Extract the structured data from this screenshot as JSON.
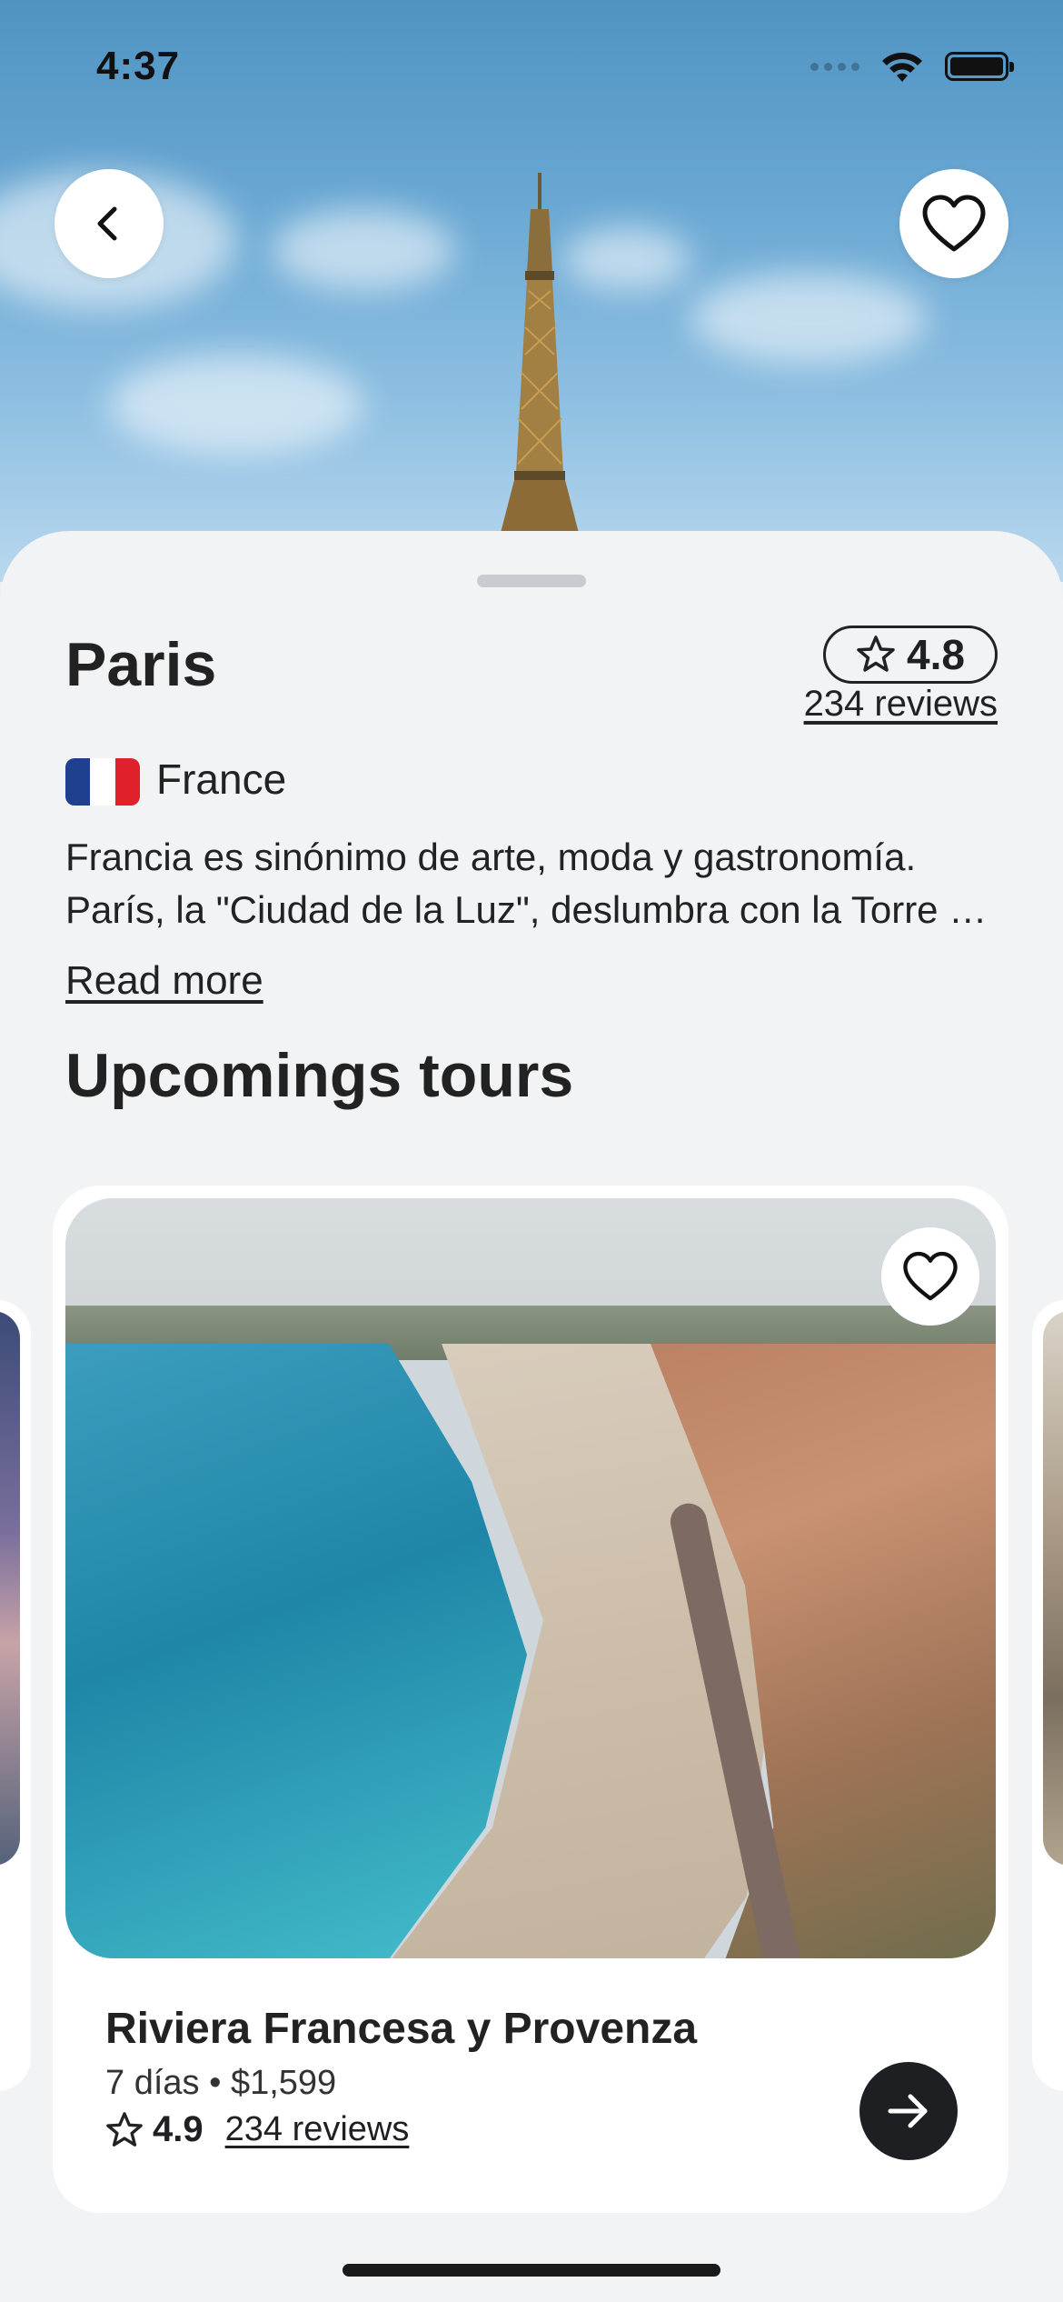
{
  "status_bar": {
    "time": "4:37"
  },
  "header": {
    "back_icon": "chevron-left-icon",
    "favorite_icon": "heart-outline-icon"
  },
  "destination": {
    "name": "Paris",
    "rating": "4.8",
    "reviews": "234 reviews",
    "country": "France",
    "flag_colors": [
      "#1f3f8f",
      "#ffffff",
      "#e0202b"
    ],
    "description_line1": "Francia es sinónimo de arte, moda y gastronomía.",
    "description_line2": "París, la \"Ciudad de la Luz\", deslumbra con la Torre Eiffel y sus museos.",
    "read_more": "Read more"
  },
  "section": {
    "title": "Upcomings tours"
  },
  "tours": [
    {
      "name": "Riviera Francesa y Provenza",
      "duration": "7 días",
      "price": "$1,599",
      "rating": "4.9",
      "reviews": "234 reviews",
      "go_icon": "arrow-right-icon",
      "favorite_icon": "heart-outline-icon"
    }
  ],
  "colors": {
    "sheet_background": "#f2f3f5",
    "accent_dark": "#1d1f22"
  }
}
